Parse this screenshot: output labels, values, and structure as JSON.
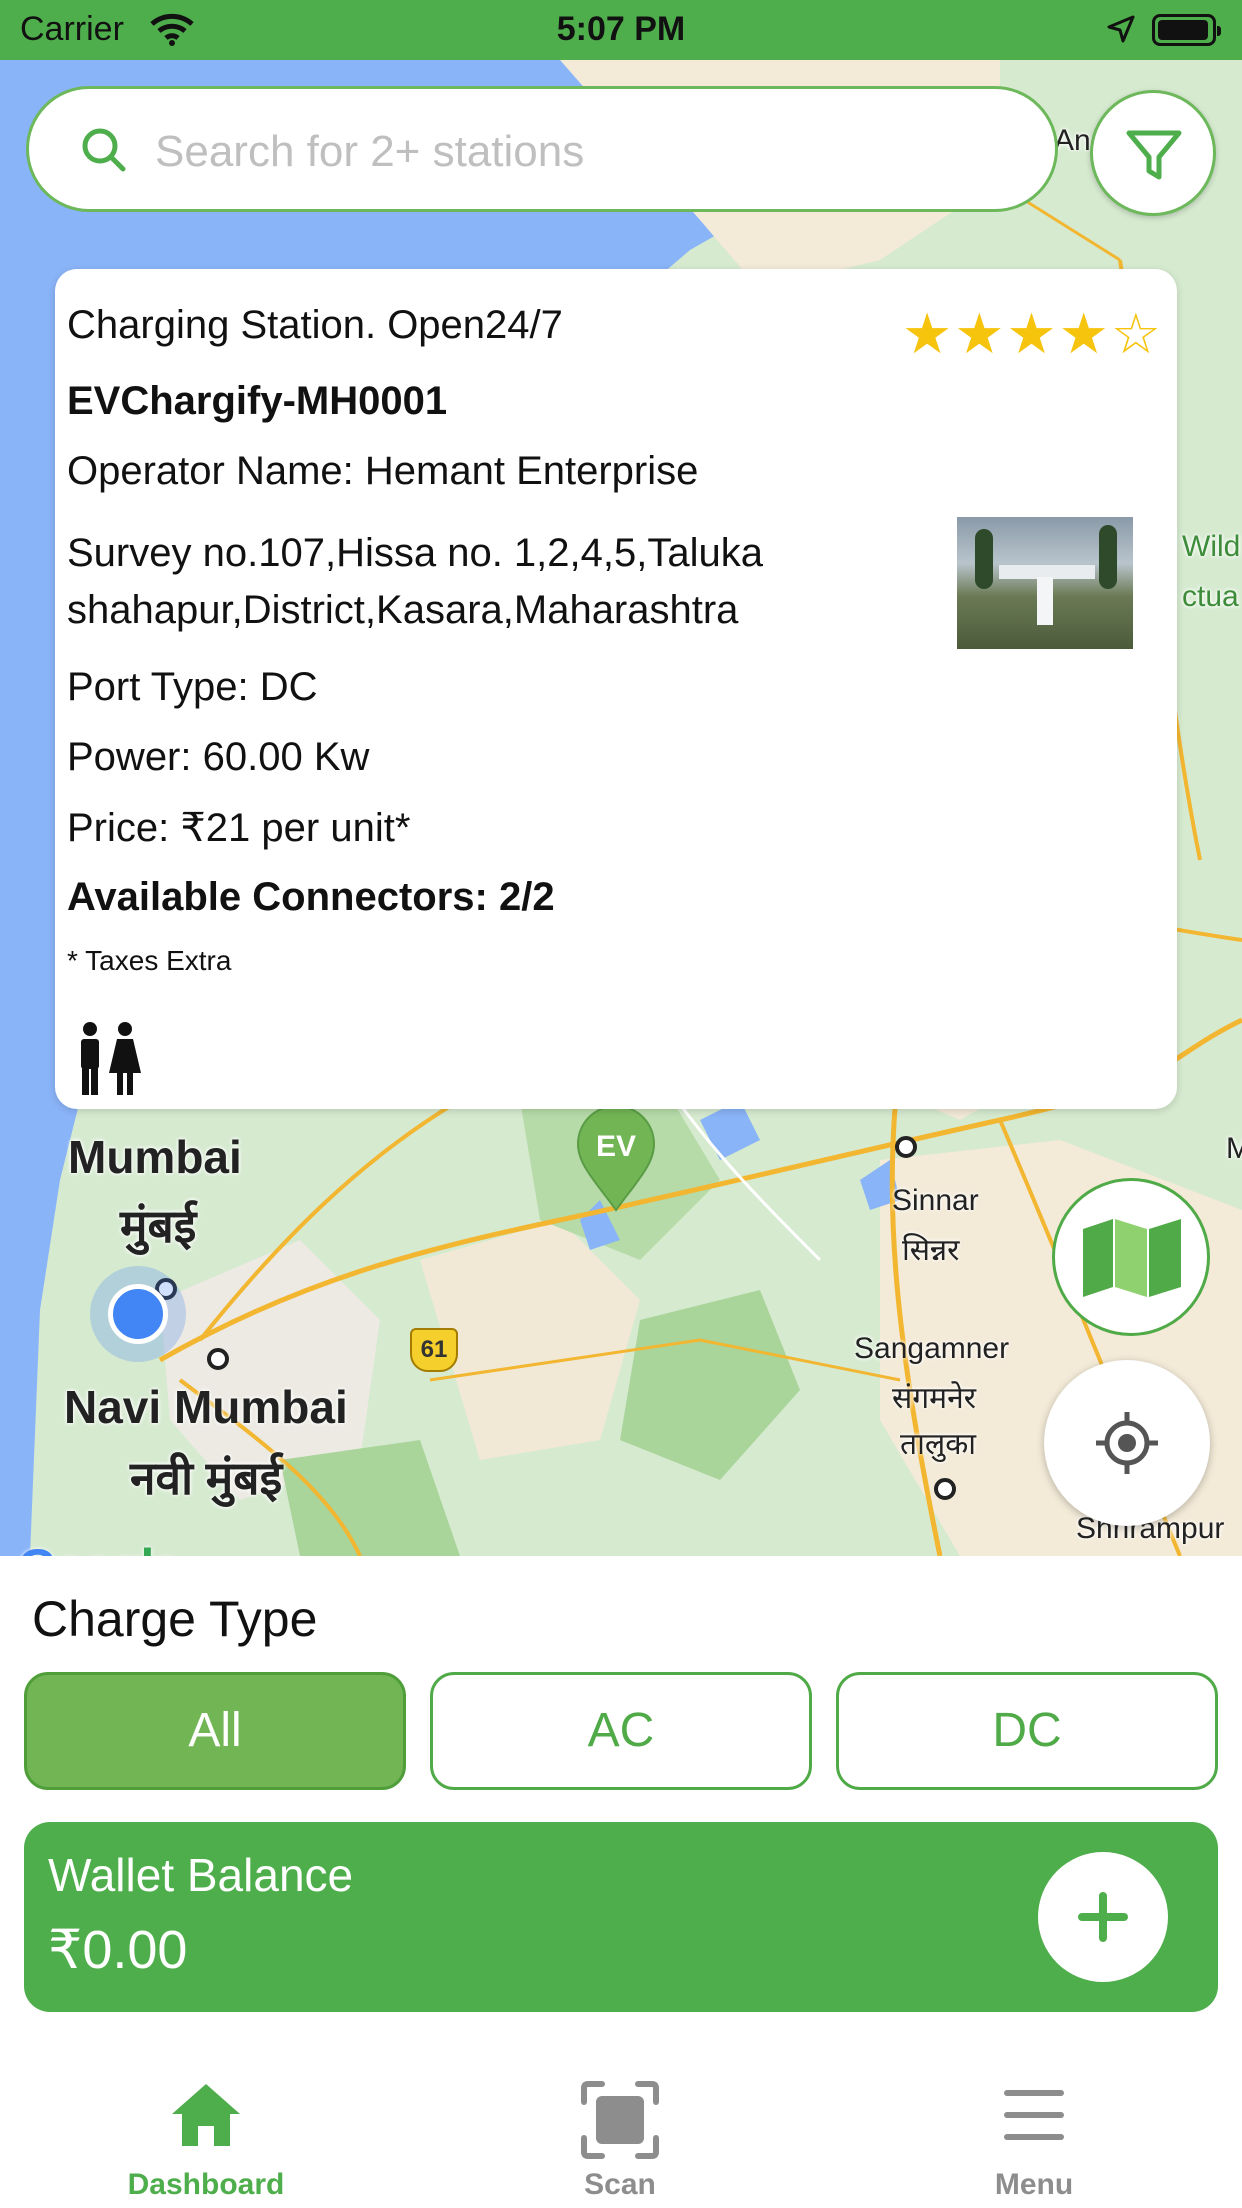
{
  "status_bar": {
    "carrier": "Carrier",
    "time": "5:07 PM"
  },
  "search": {
    "placeholder": "Search for 2+ stations"
  },
  "station_card": {
    "header": "Charging Station. Open24/7",
    "rating": 4,
    "rating_max": 5,
    "station_id": "EVChargify-MH0001",
    "operator": "Operator Name:  Hemant Enterprise",
    "address": "Survey no.107,Hissa no. 1,2,4,5,Taluka\nshahapur,District,Kasara,Maharashtra",
    "port_type": "Port Type: DC",
    "power": "Power: 60.00 Kw",
    "price": "Price:  ₹21 per unit*",
    "connectors": "Available Connectors: 2/2",
    "taxes_note": "* Taxes Extra",
    "amenity_icon": "restroom-icon"
  },
  "map": {
    "labels": {
      "mumbai_en": "Mumbai",
      "mumbai_hi": "मुंबई",
      "navi_mumbai_en": "Navi Mumbai",
      "navi_mumbai_hi": "नवी मुंबई",
      "sinnar_en": "Sinnar",
      "sinnar_hi": "सिन्नर",
      "sangamner_en": "Sangamner",
      "sangamner_hi": "संगमनेर",
      "sangamner_taluka": "तालुका",
      "shrirampur": "Shrirampur",
      "highway": "61",
      "top_right_partial": "An",
      "wild_partial": "Wild",
      "ctua_partial": "ctua",
      "m_partial": "M"
    },
    "pin_label": "EV",
    "attribution": "Google"
  },
  "charge_type": {
    "title": "Charge Type",
    "options": [
      "All",
      "AC",
      "DC"
    ],
    "selected": "All"
  },
  "wallet": {
    "label": "Wallet Balance",
    "amount": "₹0.00"
  },
  "tabs": {
    "dashboard": "Dashboard",
    "scan": "Scan",
    "menu": "Menu"
  },
  "colors": {
    "brand_green": "#4fae4c",
    "chip_active": "#72b554",
    "star": "#f6c30d",
    "location_blue": "#4285f4"
  }
}
